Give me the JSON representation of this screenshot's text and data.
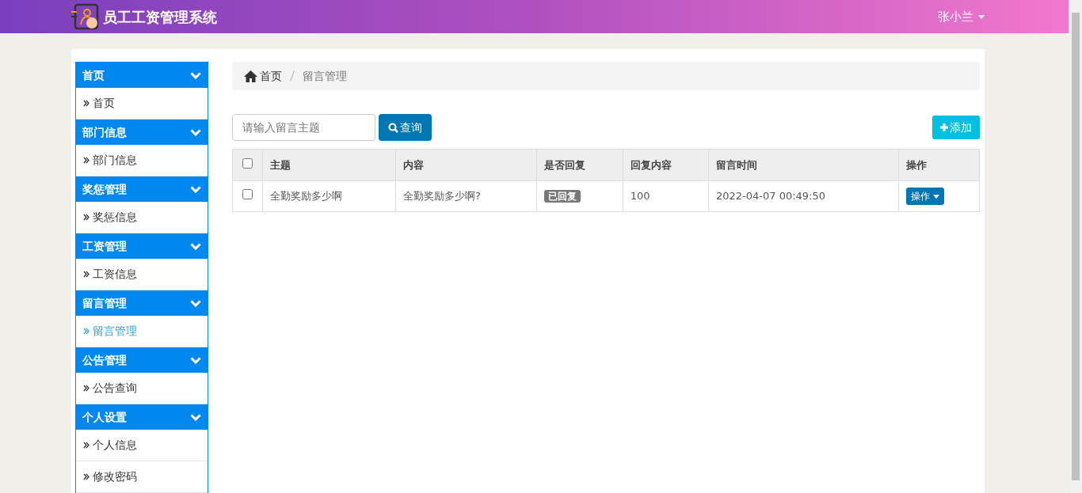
{
  "app": {
    "title": "员工工资管理系统",
    "user": "张小兰"
  },
  "sidebar": [
    {
      "title": "首页",
      "expanded": true,
      "items": [
        {
          "label": "首页",
          "selected": false
        }
      ]
    },
    {
      "title": "部门信息",
      "expanded": true,
      "items": [
        {
          "label": "部门信息",
          "selected": false
        }
      ]
    },
    {
      "title": "奖惩管理",
      "expanded": true,
      "items": [
        {
          "label": "奖惩信息",
          "selected": false
        }
      ]
    },
    {
      "title": "工资管理",
      "expanded": true,
      "items": [
        {
          "label": "工资信息",
          "selected": false
        }
      ]
    },
    {
      "title": "留言管理",
      "expanded": true,
      "items": [
        {
          "label": "留言管理",
          "selected": true
        }
      ]
    },
    {
      "title": "公告管理",
      "expanded": true,
      "items": [
        {
          "label": "公告查询",
          "selected": false
        }
      ]
    },
    {
      "title": "个人设置",
      "expanded": true,
      "items": [
        {
          "label": "个人信息",
          "selected": false
        },
        {
          "label": "修改密码",
          "selected": false
        }
      ]
    }
  ],
  "breadcrumb": [
    "首页",
    "留言管理"
  ],
  "search": {
    "placeholder": "请输入留言主题",
    "button": "查询"
  },
  "add_button": "添加",
  "table": {
    "select_all_checked": false,
    "columns": [
      "主题",
      "内容",
      "是否回复",
      "回复内容",
      "留言时间",
      "操作"
    ],
    "rows": [
      {
        "checked": false,
        "subject": "全勤奖励多少啊",
        "content": "全勤奖励多少啊?",
        "replied": true,
        "reply_status": "已回复",
        "reply": "100",
        "time": "2022-04-07 00:49:50",
        "action": "操作"
      }
    ]
  }
}
